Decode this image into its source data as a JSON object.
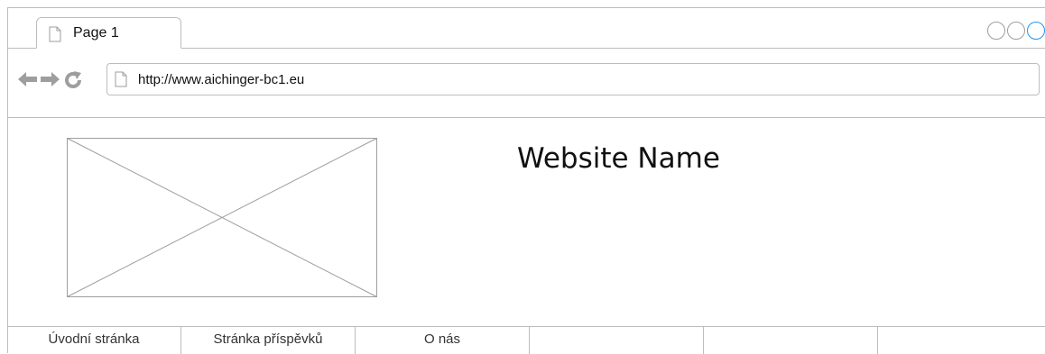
{
  "browser": {
    "tab_title": "Page 1",
    "url": "http://www.aichinger-bc1.eu"
  },
  "site": {
    "name": "Website Name"
  },
  "nav": {
    "items": [
      "Úvodní stránka",
      "Stránka příspěvků",
      "O nás",
      "",
      "",
      ""
    ]
  },
  "icons": {
    "tab_icon": "document-icon",
    "back": "back-arrow-icon",
    "forward": "forward-arrow-icon",
    "reload": "reload-icon",
    "url_icon": "document-icon",
    "image_placeholder": "image-placeholder-icon"
  },
  "colors": {
    "border": "#bdbdbd",
    "icon_gray": "#9e9e9e",
    "accent_circle": "#2196f3"
  }
}
